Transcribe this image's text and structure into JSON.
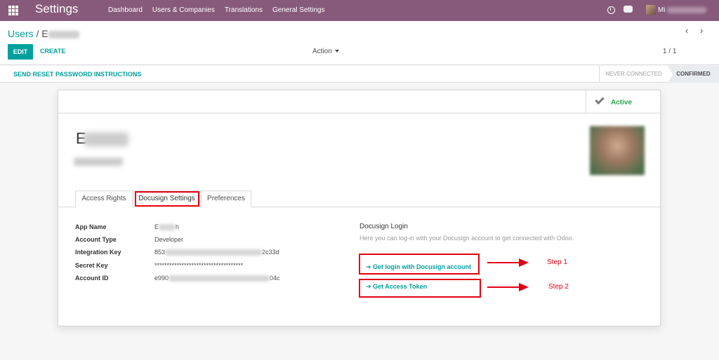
{
  "navbar": {
    "brand": "Settings",
    "menu": [
      "Dashboard",
      "Users & Companies",
      "Translations",
      "General Settings"
    ],
    "user_name": "Mi"
  },
  "control": {
    "breadcrumb_root": "Users",
    "breadcrumb_sep": "/",
    "breadcrumb_current": "E",
    "edit_label": "EDIT",
    "create_label": "CREATE",
    "action_label": "Action",
    "pager": "1 / 1",
    "prev": "‹",
    "next": "›"
  },
  "statusbar": {
    "reset_label": "SEND RESET PASSWORD INSTRUCTIONS",
    "states": [
      "NEVER CONNECTED",
      "CONFIRMED"
    ],
    "current_state": "CONFIRMED"
  },
  "sheet": {
    "active_label": "Active",
    "record_name": "E",
    "tabs": [
      "Access Rights",
      "Docusign Settings",
      "Preferences"
    ],
    "active_tab": "Docusign Settings",
    "fields": [
      {
        "label": "App Name",
        "value_start": "E",
        "value_end": "h"
      },
      {
        "label": "Account Type",
        "value_start": "Developer",
        "value_end": ""
      },
      {
        "label": "Integration Key",
        "value_start": "853",
        "value_end": "2c33d"
      },
      {
        "label": "Secret Key",
        "value_start": "************************************",
        "value_end": ""
      },
      {
        "label": "Account ID",
        "value_start": "e990",
        "value_end": "04c"
      }
    ],
    "docusign": {
      "title": "Docusign Login",
      "help": "Here you can log-in with your Docusign account to get connected with Odoo.",
      "login_link": "➔ Get login with Docusign account",
      "token_link": "➔ Get Access Token",
      "step1": "Step 1",
      "step2": "Step 2"
    }
  },
  "colors": {
    "navbar": "#875a7b",
    "accent": "#00a09d",
    "annotation": "#e3000f",
    "active": "#28a745"
  }
}
